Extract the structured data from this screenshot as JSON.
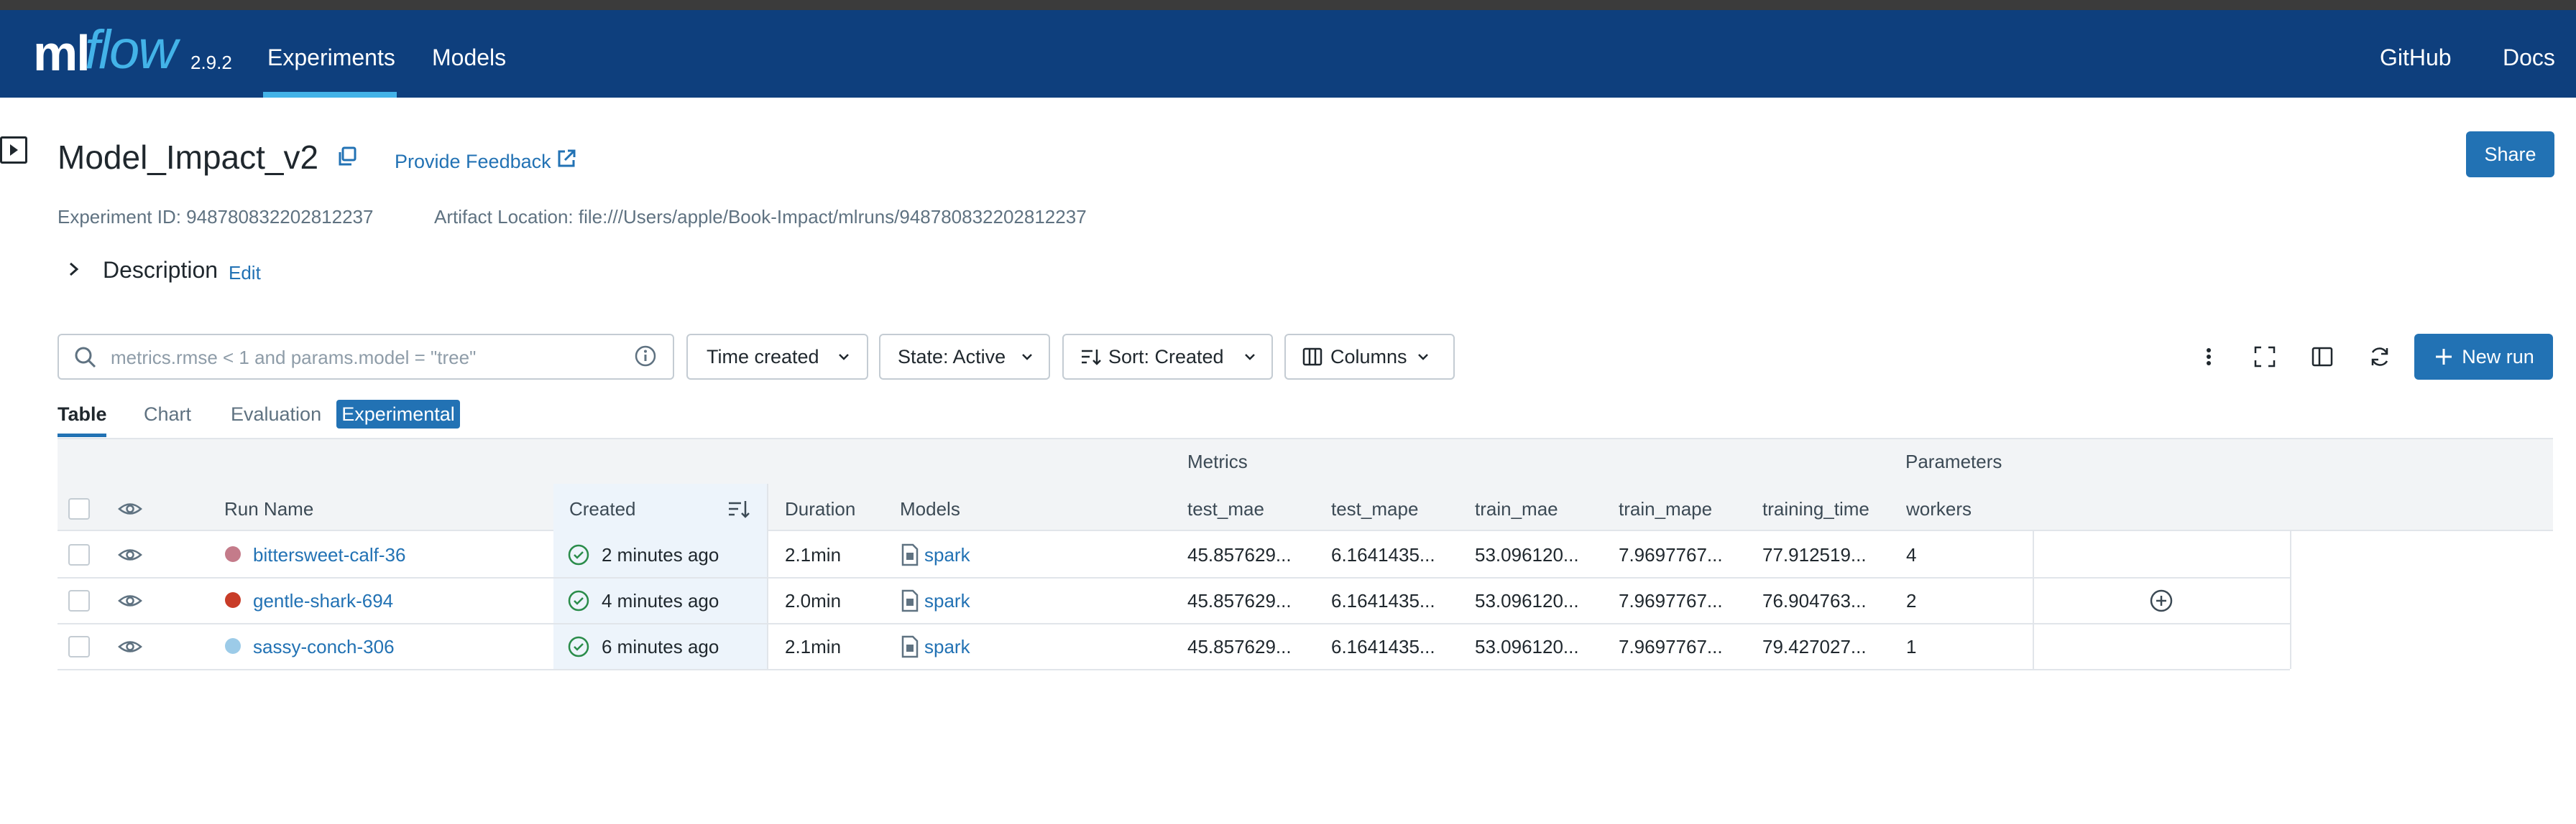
{
  "app": {
    "logo_ml": "ml",
    "logo_flow": "flow",
    "version": "2.9.2",
    "nav_left": [
      "Experiments",
      "Models"
    ],
    "nav_right": [
      "GitHub",
      "Docs"
    ],
    "accent": "#43b3e8",
    "navbar_color": "#0e3f7d",
    "primary_color": "#2272b4"
  },
  "header": {
    "title": "Model_Impact_v2",
    "feedback": "Provide Feedback",
    "share": "Share",
    "experiment_id": "Experiment ID: 948780832202812237",
    "artifact_location": "Artifact Location: file:///Users/apple/Book-Impact/mlruns/948780832202812237",
    "description": "Description",
    "edit": "Edit"
  },
  "controls": {
    "search_placeholder": "metrics.rmse < 1 and params.model = \"tree\"",
    "time_created": "Time created",
    "state": "State: Active",
    "sort": "Sort: Created",
    "columns": "Columns",
    "new_run": "New run"
  },
  "tabs": {
    "table": "Table",
    "chart": "Chart",
    "evaluation": "Evaluation",
    "experimental": "Experimental"
  },
  "table": {
    "group_metrics": "Metrics",
    "group_parameters": "Parameters",
    "headers": {
      "run_name": "Run Name",
      "created": "Created",
      "duration": "Duration",
      "models": "Models",
      "test_mae": "test_mae",
      "test_mape": "test_mape",
      "train_mae": "train_mae",
      "train_mape": "train_mape",
      "training_time": "training_time",
      "workers": "workers"
    },
    "rows": [
      {
        "name": "bittersweet-calf-36",
        "color": "#c47b8a",
        "created": "2 minutes ago",
        "duration": "2.1min",
        "model": "spark",
        "test_mae": "45.857629...",
        "test_mape": "6.1641435...",
        "train_mae": "53.096120...",
        "train_mape": "7.9697767...",
        "training_time": "77.912519...",
        "workers": "4"
      },
      {
        "name": "gentle-shark-694",
        "color": "#c83c28",
        "created": "4 minutes ago",
        "duration": "2.0min",
        "model": "spark",
        "test_mae": "45.857629...",
        "test_mape": "6.1641435...",
        "train_mae": "53.096120...",
        "train_mape": "7.9697767...",
        "training_time": "76.904763...",
        "workers": "2"
      },
      {
        "name": "sassy-conch-306",
        "color": "#9ccbe8",
        "created": "6 minutes ago",
        "duration": "2.1min",
        "model": "spark",
        "test_mae": "45.857629...",
        "test_mape": "6.1641435...",
        "train_mae": "53.096120...",
        "train_mape": "7.9697767...",
        "training_time": "79.427027...",
        "workers": "1"
      }
    ]
  }
}
